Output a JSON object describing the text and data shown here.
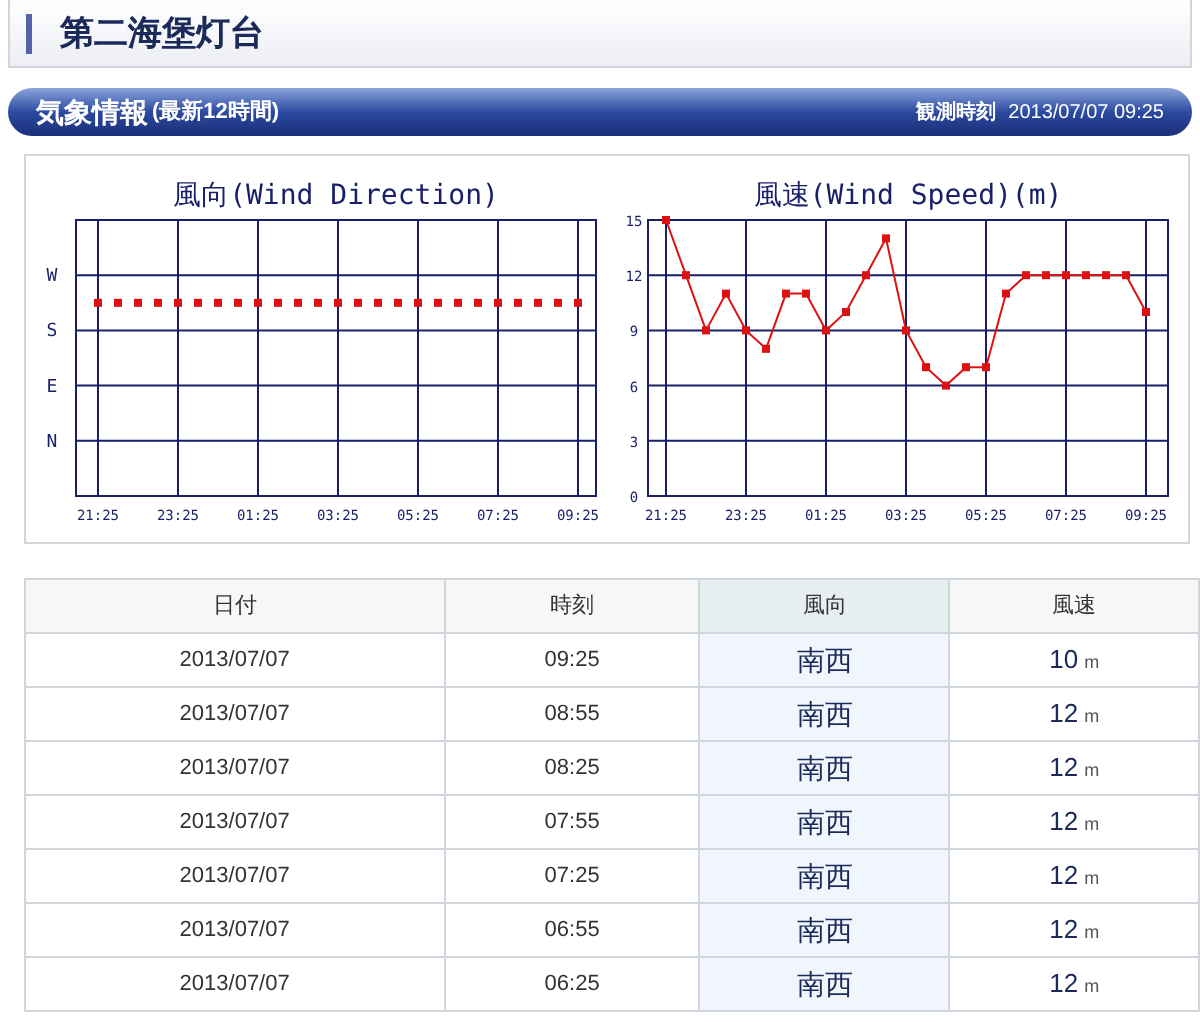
{
  "page_title": "第二海堡灯台",
  "section": {
    "title": "気象情報",
    "subtitle": "(最新12時間)",
    "observed_label": "観測時刻",
    "observed_time": "2013/07/07 09:25"
  },
  "charts": [
    {
      "kind": "direction",
      "title": "風向(Wind Direction)",
      "y_labels": [
        "W",
        "S",
        "E",
        "N"
      ],
      "x_labels": [
        "21:25",
        "23:25",
        "01:25",
        "03:25",
        "05:25",
        "07:25",
        "09:25"
      ]
    },
    {
      "kind": "data",
      "chart_data": {
        "type": "line",
        "title": "風速(Wind Speed)(m)",
        "grid": true,
        "categories": [
          "21:25",
          null,
          null,
          null,
          "23:25",
          null,
          null,
          null,
          "01:25",
          null,
          null,
          null,
          "03:25",
          null,
          null,
          null,
          "05:25",
          null,
          null,
          null,
          "07:25",
          null,
          null,
          null,
          "09:25"
        ],
        "series": [
          {
            "color": "#dd1111",
            "marker": "square",
            "values": [
              15,
              12,
              9,
              11,
              9,
              8,
              11,
              11,
              9,
              10,
              12,
              14,
              9,
              7,
              6,
              7,
              7,
              11,
              12,
              12,
              12,
              12,
              12,
              12,
              10
            ]
          }
        ],
        "ylim": [
          0,
          15
        ],
        "yticks": [
          0,
          3,
          6,
          9,
          12,
          15
        ]
      }
    }
  ],
  "table": {
    "columns": [
      {
        "label": "日付",
        "highlighted": false
      },
      {
        "label": "時刻",
        "highlighted": false
      },
      {
        "label": "風向",
        "highlighted": true
      },
      {
        "label": "風速",
        "highlighted": false
      }
    ],
    "rows": [
      {
        "date": "2013/07/07",
        "time": "09:25",
        "direction": "南西",
        "speed": "10",
        "unit": "m"
      },
      {
        "date": "2013/07/07",
        "time": "08:55",
        "direction": "南西",
        "speed": "12",
        "unit": "m"
      },
      {
        "date": "2013/07/07",
        "time": "08:25",
        "direction": "南西",
        "speed": "12",
        "unit": "m"
      },
      {
        "date": "2013/07/07",
        "time": "07:55",
        "direction": "南西",
        "speed": "12",
        "unit": "m"
      },
      {
        "date": "2013/07/07",
        "time": "07:25",
        "direction": "南西",
        "speed": "12",
        "unit": "m"
      },
      {
        "date": "2013/07/07",
        "time": "06:55",
        "direction": "南西",
        "speed": "12",
        "unit": "m"
      },
      {
        "date": "2013/07/07",
        "time": "06:25",
        "direction": "南西",
        "speed": "12",
        "unit": "m"
      }
    ]
  }
}
